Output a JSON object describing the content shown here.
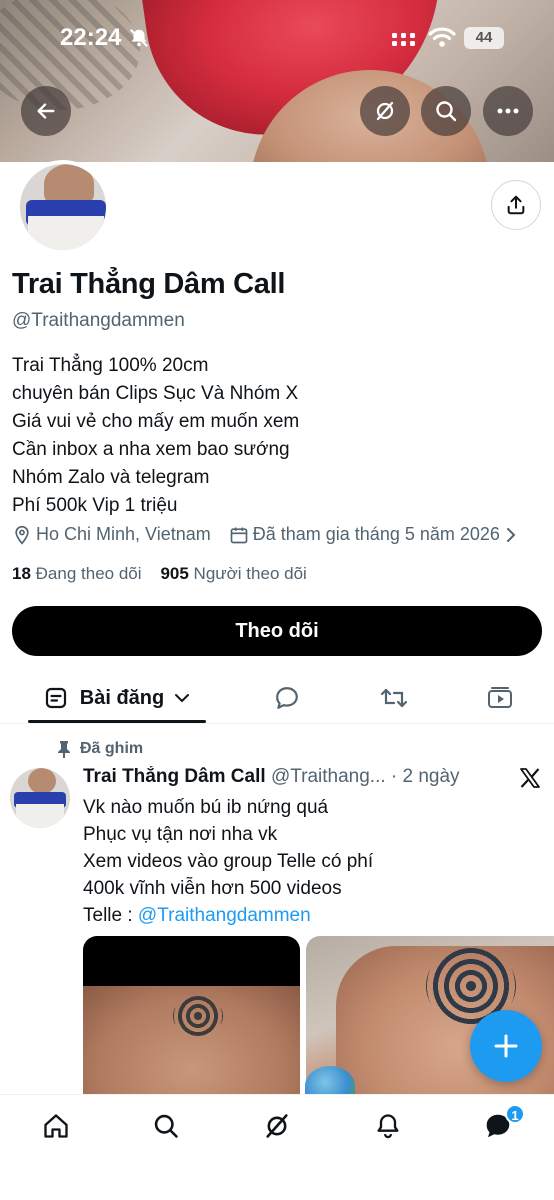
{
  "status_bar": {
    "time": "22:24",
    "battery": "44"
  },
  "profile": {
    "name": "Trai Thẳng Dâm Call",
    "handle": "@Traithangdammen",
    "bio": [
      "Trai Thẳng 100% 20cm",
      "chuyên bán Clips Sục Và Nhóm X",
      "Giá vui vẻ cho mấy em muốn xem",
      "Cần inbox a nha xem bao sướng",
      "Nhóm Zalo và telegram",
      "Phí 500k Vip 1 triệu"
    ],
    "location": "Ho Chi Minh, Vietnam",
    "joined": "Đã tham gia tháng 5 năm 2026",
    "following_count": "18",
    "following_label": "Đang theo dõi",
    "followers_count": "905",
    "followers_label": "Người theo dõi",
    "follow_button": "Theo dõi"
  },
  "tabs": {
    "active_label": "Bài đăng"
  },
  "post": {
    "pinned_label": "Đã ghim",
    "author": "Trai Thẳng Dâm Call",
    "handle": "@Traithang...",
    "time": "· 2 ngày",
    "lines": [
      "Vk nào muốn bú ib nứng quá",
      "Phục vụ tận nơi nha vk",
      "Xem videos vào group Telle có phí",
      "400k vĩnh viễn hơn 500 videos"
    ],
    "telle_prefix": "Telle : ",
    "telle_link": "@Traithangdammen"
  },
  "nav": {
    "messages_badge": "1"
  },
  "colors": {
    "accent": "#1d9bf0",
    "text": "#0f1419",
    "muted": "#536471"
  }
}
